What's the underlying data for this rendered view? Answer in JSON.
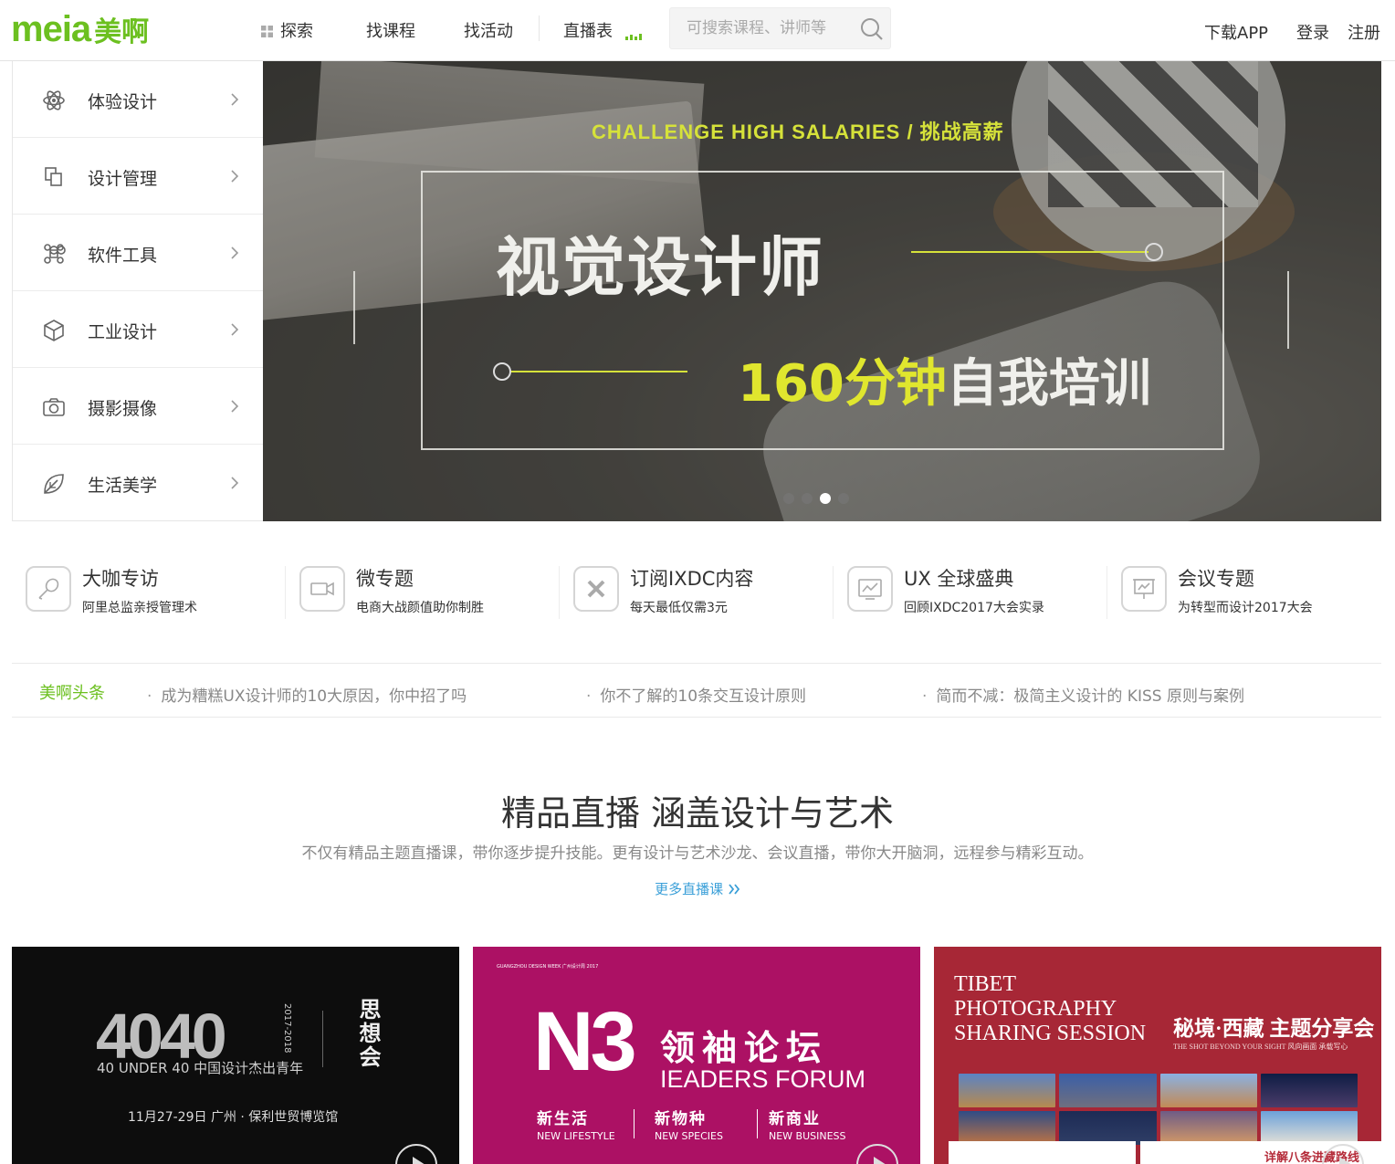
{
  "header": {
    "logo_en": "meia",
    "logo_cn": "美啊",
    "nav": [
      {
        "label": "探索"
      },
      {
        "label": "找课程"
      },
      {
        "label": "找活动"
      },
      {
        "label": "直播表"
      }
    ],
    "search_placeholder": "可搜索课程、讲师等",
    "download_app": "下载APP",
    "login": "登录",
    "register": "注册"
  },
  "sidebar": {
    "items": [
      {
        "label": "体验设计",
        "icon": "atom-icon"
      },
      {
        "label": "设计管理",
        "icon": "copy-icon"
      },
      {
        "label": "软件工具",
        "icon": "command-icon"
      },
      {
        "label": "工业设计",
        "icon": "cube-icon"
      },
      {
        "label": "摄影摄像",
        "icon": "camera-icon"
      },
      {
        "label": "生活美学",
        "icon": "leaf-icon"
      }
    ]
  },
  "banner": {
    "subtitle": "CHALLENGE  HIGH  SALARIES  /  挑战高薪",
    "title": "视觉设计师",
    "bottom_yellow": "160分钟",
    "bottom_white": "自我培训",
    "slides": 4,
    "active_slide": 2
  },
  "features": [
    {
      "title": "大咖专访",
      "subtitle": "阿里总监亲授管理术",
      "icon": "pen-icon"
    },
    {
      "title": "微专题",
      "subtitle": "电商大战颜值助你制胜",
      "icon": "video-icon"
    },
    {
      "title": "订阅IXDC内容",
      "subtitle": "每天最低仅需3元",
      "icon": "tools-icon"
    },
    {
      "title": "UX 全球盛典",
      "subtitle": "回顾IXDC2017大会实录",
      "icon": "chart-icon"
    },
    {
      "title": "会议专题",
      "subtitle": "为转型而设计2017大会",
      "icon": "presentation-icon"
    }
  ],
  "headlines": {
    "label": "美啊头条",
    "items": [
      "成为糟糕UX设计师的10大原因，你中招了吗",
      "你不了解的10条交互设计原则",
      "简而不减：极简主义设计的 KISS 原则与案例"
    ]
  },
  "section": {
    "title": "精品直播 涵盖设计与艺术",
    "description": "不仅有精品主题直播课，带你逐步提升技能。更有设计与艺术沙龙、会议直播，带你大开脑洞，远程参与精彩互动。",
    "more": "更多直播课"
  },
  "cards": [
    {
      "big": "4040",
      "year": "2017-2018",
      "vertical": "思想会",
      "subtitle": "40 UNDER 40 中国设计杰出青年",
      "date": "11月27-29日 广州 · 保利世贸博览馆"
    },
    {
      "top": "GUANGZHOU DESIGN WEEK 广州设计周 2017",
      "n3": "N3",
      "cn": "领袖论坛",
      "en": "IEADERS FORUM",
      "cols": [
        {
          "a": "新生活",
          "b": "NEW LIFESTYLE"
        },
        {
          "a": "新物种",
          "b": "NEW SPECIES"
        },
        {
          "a": "新商业",
          "b": "NEW BUSINESS"
        }
      ]
    },
    {
      "en_lines": [
        "TIBET",
        "PHOTOGRAPHY",
        "SHARING SESSION"
      ],
      "cn": "秘境·西藏 主题分享会",
      "cn_sub": "THE SHOT BEYOND YOUR SIGHT 风向画面 承载写心",
      "bottom": "详解八条进藏路线"
    }
  ],
  "colors": {
    "brand_green": "#6cc020",
    "link_blue": "#3a9fd8",
    "banner_yellow": "#d6e23a",
    "card2_bg": "#ac1164",
    "card3_bg": "#a72736"
  }
}
